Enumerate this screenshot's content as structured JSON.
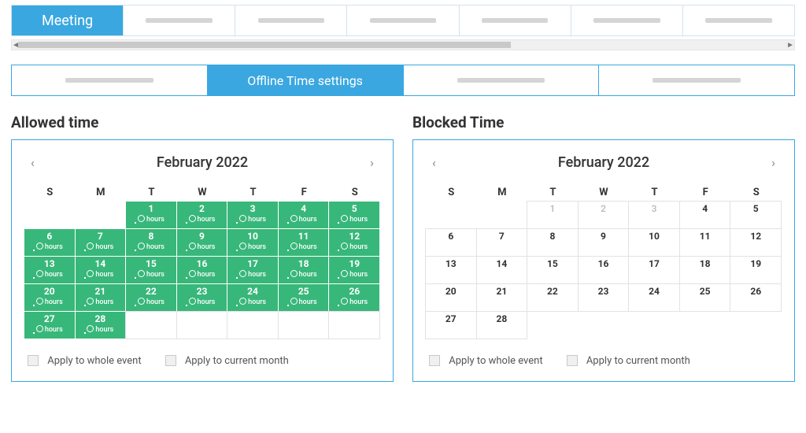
{
  "top_tabs": {
    "active_label": "Meeting",
    "placeholder_count": 6
  },
  "sub_tabs": {
    "active_label": "Offline Time settings",
    "placeholder_count": 3
  },
  "allowed": {
    "title": "Allowed time",
    "month": "February 2022",
    "weekdays": [
      "S",
      "M",
      "T",
      "W",
      "T",
      "F",
      "S"
    ],
    "lead_blanks": 2,
    "days": [
      1,
      2,
      3,
      4,
      5,
      6,
      7,
      8,
      9,
      10,
      11,
      12,
      13,
      14,
      15,
      16,
      17,
      18,
      19,
      20,
      21,
      22,
      23,
      24,
      25,
      26,
      27,
      28
    ],
    "day_sub": "hours",
    "trail_blanks": 5,
    "apply_whole": "Apply to whole event",
    "apply_month": "Apply to current month"
  },
  "blocked": {
    "title": "Blocked Time",
    "month": "February 2022",
    "weekdays": [
      "S",
      "M",
      "T",
      "W",
      "T",
      "F",
      "S"
    ],
    "lead_blanks": 2,
    "days": [
      1,
      2,
      3,
      4,
      5,
      6,
      7,
      8,
      9,
      10,
      11,
      12,
      13,
      14,
      15,
      16,
      17,
      18,
      19,
      20,
      21,
      22,
      23,
      24,
      25,
      26,
      27,
      28
    ],
    "outside_prefix": [
      1,
      2,
      3
    ],
    "trail_blanks": 5,
    "apply_whole": "Apply to whole event",
    "apply_month": "Apply to current month"
  }
}
